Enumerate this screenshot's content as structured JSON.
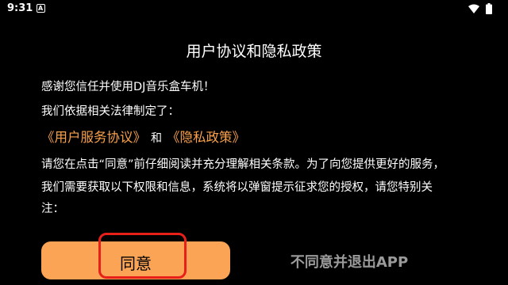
{
  "status_bar": {
    "time": "9:31",
    "notification_icon": "a-notification-icon",
    "wifi_icon": "wifi-icon",
    "battery_icon": "battery-icon"
  },
  "dialog": {
    "title": "用户协议和隐私政策",
    "line1": "感谢您信任并使用DJ音乐盒车机！",
    "line2": "我们依据相关法律制定了：",
    "user_agreement_link": "《用户服务协议》",
    "and_text": "和",
    "privacy_policy_link": "《隐私政策》",
    "body_line1": "请您在点击“同意”前仔细阅读并充分理解相关条款。为了向您提供更好的服务，",
    "body_line2": "我们需要获取以下权限和信息，系统将以弹窗提示征求您的授权，请您特别关",
    "body_line3": "注："
  },
  "buttons": {
    "agree": "同意",
    "disagree": "不同意并退出APP"
  },
  "colors": {
    "background": "#000000",
    "accent": "#fba456",
    "link": "#f8a04a",
    "highlight": "#e8201a",
    "disabled_text": "#9a9a9a"
  }
}
